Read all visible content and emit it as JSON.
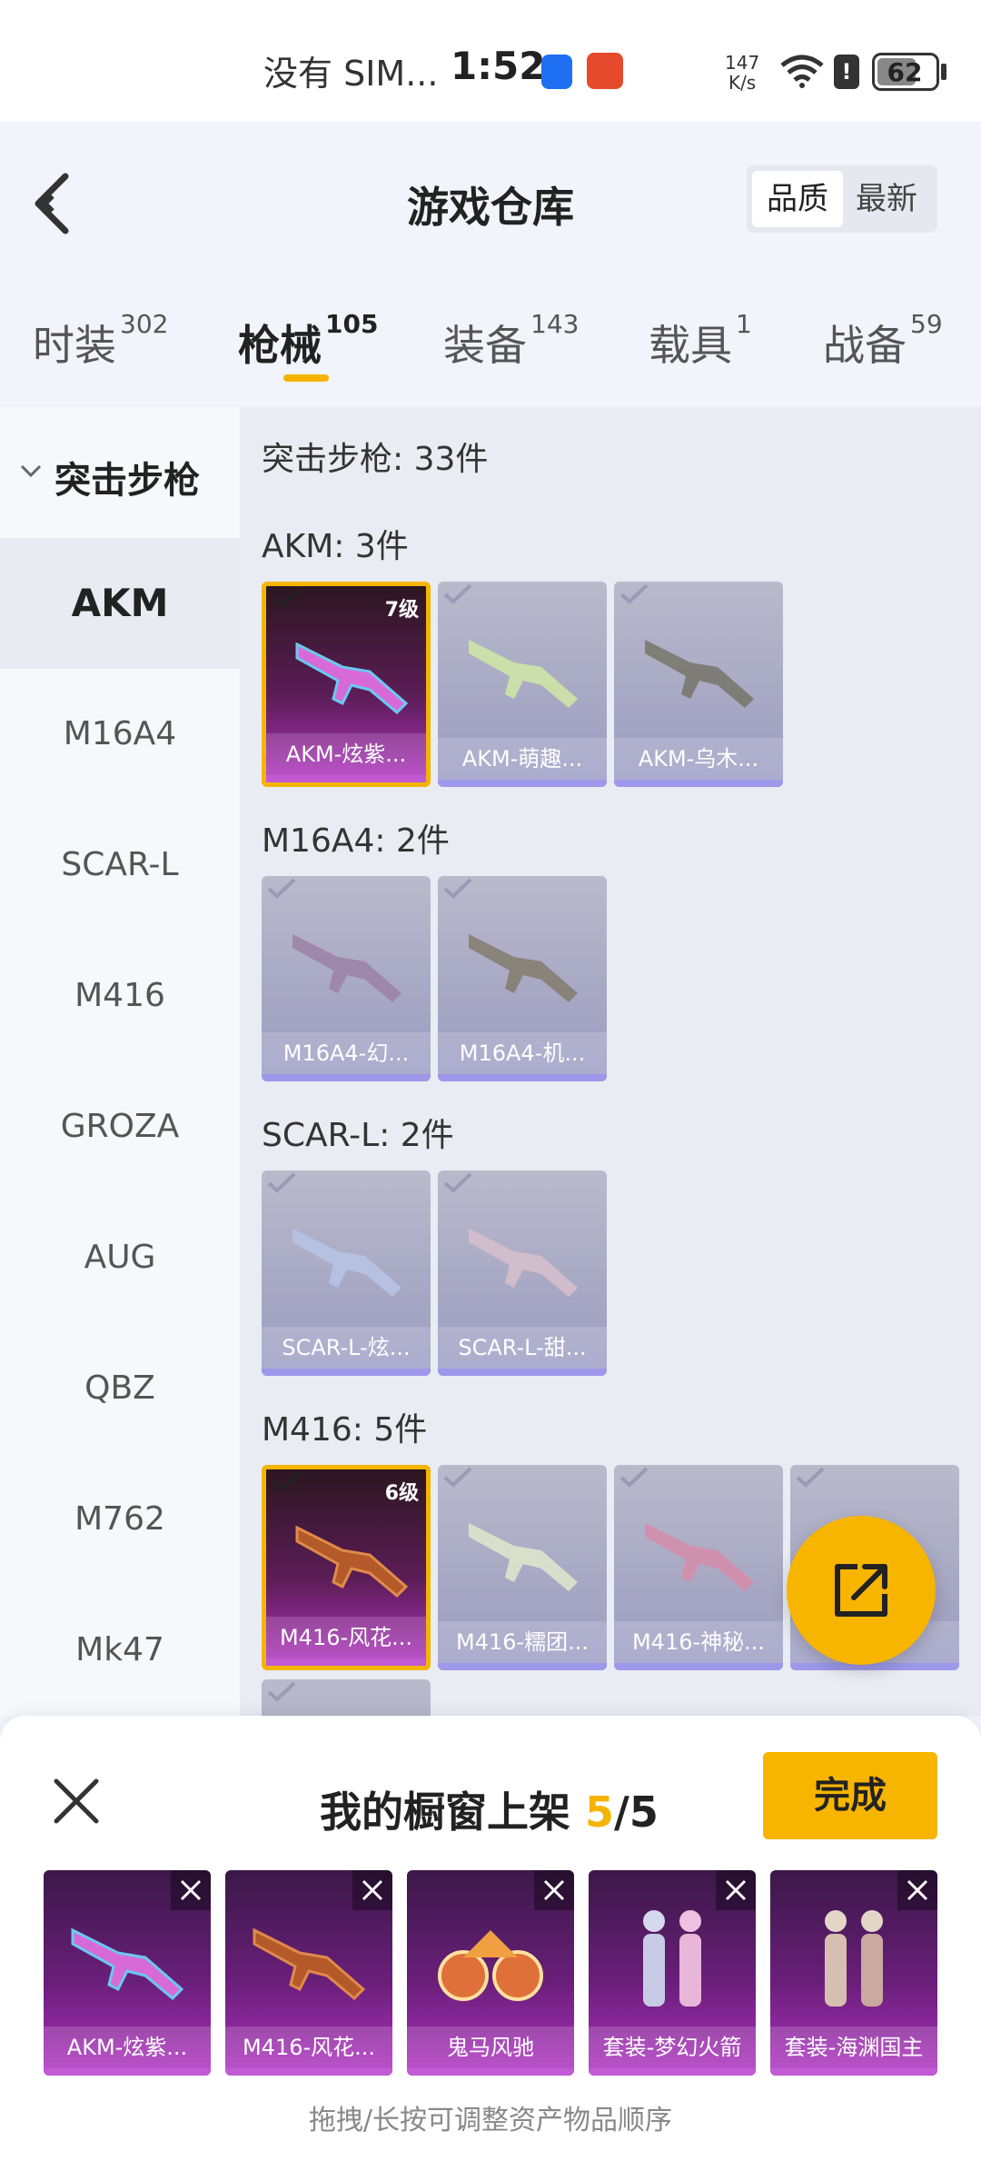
{
  "status_bar": {
    "carrier": "没有 SIM...",
    "time": "1:52",
    "net_speed_value": "147",
    "net_speed_unit": "K/s",
    "battery": "62"
  },
  "header": {
    "title": "游戏仓库",
    "sort_options": [
      "品质",
      "最新"
    ],
    "sort_active": "品质"
  },
  "tabs": [
    {
      "label": "时装",
      "count": "302"
    },
    {
      "label": "枪械",
      "count": "105",
      "active": true
    },
    {
      "label": "装备",
      "count": "143"
    },
    {
      "label": "载具",
      "count": "1"
    },
    {
      "label": "战备",
      "count": "59"
    }
  ],
  "sidebar": {
    "group": "突击步枪",
    "items": [
      "AKM",
      "M16A4",
      "SCAR-L",
      "M416",
      "GROZA",
      "AUG",
      "QBZ",
      "M762",
      "Mk47"
    ],
    "active": "AKM"
  },
  "content": {
    "summary": "突击步枪: 33件",
    "sections": [
      {
        "title": "AKM: 3件",
        "items": [
          {
            "name": "AKM-炫紫...",
            "level": "7级",
            "selected": true
          },
          {
            "name": "AKM-萌趣..."
          },
          {
            "name": "AKM-乌木..."
          }
        ]
      },
      {
        "title": "M16A4: 2件",
        "items": [
          {
            "name": "M16A4-幻..."
          },
          {
            "name": "M16A4-机..."
          }
        ]
      },
      {
        "title": "SCAR-L: 2件",
        "items": [
          {
            "name": "SCAR-L-炫..."
          },
          {
            "name": "SCAR-L-甜..."
          }
        ]
      },
      {
        "title": "M416: 5件",
        "items": [
          {
            "name": "M416-风花...",
            "level": "6级",
            "selected": true
          },
          {
            "name": "M416-糯团..."
          },
          {
            "name": "M416-神秘..."
          },
          {
            "name": ""
          }
        ]
      }
    ]
  },
  "panel": {
    "title": "我的橱窗上架",
    "current": "5",
    "total": "/5",
    "done_label": "完成",
    "shelf": [
      "AKM-炫紫...",
      "M416-风花...",
      "鬼马风驰",
      "套装-梦幻火箭",
      "套装-海渊国主"
    ],
    "hint": "拖拽/长按可调整资产物品顺序"
  },
  "colors": {
    "accent": "#f5b400",
    "purple_rarity": "#b131c3",
    "grey_card": "#a4a4c3"
  }
}
